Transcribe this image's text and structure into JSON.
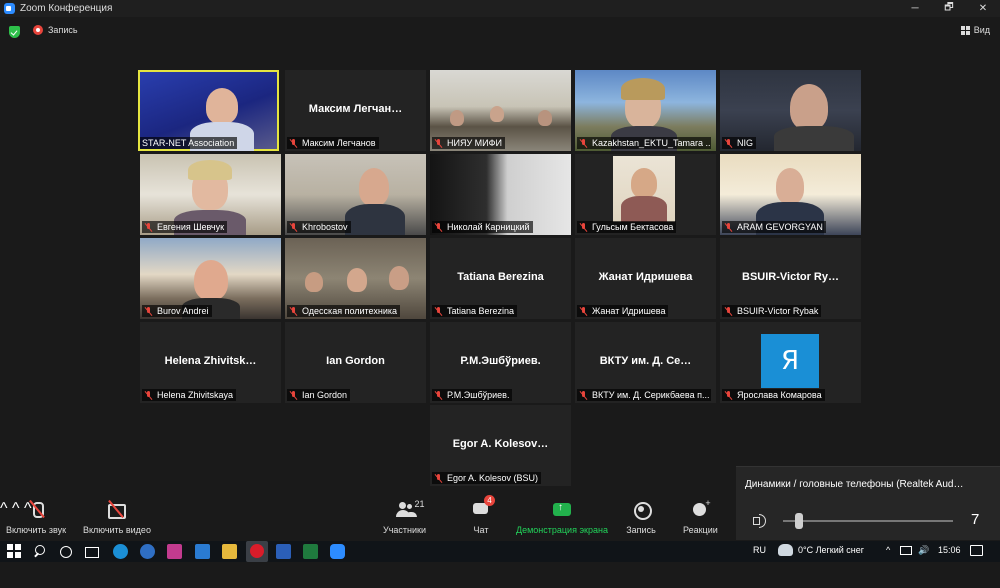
{
  "window": {
    "title": "Zoom Конференция",
    "minimize": "─",
    "maximize": "🗗",
    "close": "✕"
  },
  "topbar": {
    "recording": "Запись",
    "view": "Вид"
  },
  "tiles": [
    {
      "id": "star",
      "label": "STAR-NET Association",
      "big": "",
      "video": true,
      "muted": false,
      "active": true
    },
    {
      "id": "maksim",
      "label": "Максим Легчанов",
      "big": "Максим Легчан…",
      "video": false,
      "muted": true
    },
    {
      "id": "niyau",
      "label": "НИЯУ МИФИ",
      "big": "",
      "video": true,
      "muted": true
    },
    {
      "id": "kaz",
      "label": "Kazakhstan_EKTU_Tamara ...",
      "big": "",
      "video": true,
      "muted": true
    },
    {
      "id": "nig",
      "label": "NIG",
      "big": "",
      "video": true,
      "muted": true
    },
    {
      "id": "shevchuk",
      "label": "Евгения Шевчук",
      "big": "",
      "video": true,
      "muted": true
    },
    {
      "id": "khrobostov",
      "label": "Khrobostov",
      "big": "",
      "video": true,
      "muted": true
    },
    {
      "id": "karnitsky",
      "label": "Николай Карницкий",
      "big": "",
      "video": true,
      "muted": true
    },
    {
      "id": "bektasova",
      "label": "Гульсым Бектасова",
      "big": "",
      "video": true,
      "muted": true
    },
    {
      "id": "aram",
      "label": "ARAM GEVORGYAN",
      "big": "",
      "video": true,
      "muted": true
    },
    {
      "id": "burov",
      "label": "Burov Andrei",
      "big": "",
      "video": true,
      "muted": true
    },
    {
      "id": "odessa",
      "label": "Одесская политехника",
      "big": "",
      "video": true,
      "muted": true
    },
    {
      "id": "berezina",
      "label": "Tatiana Berezina",
      "big": "Tatiana Berezina",
      "video": false,
      "muted": true
    },
    {
      "id": "idrisheva",
      "label": "Жанат Идришева",
      "big": "Жанат Идришева",
      "video": false,
      "muted": true
    },
    {
      "id": "bsuir",
      "label": "BSUIR-Victor Rybak",
      "big": "BSUIR-Victor Ry…",
      "video": false,
      "muted": true
    },
    {
      "id": "zhivitskaya",
      "label": "Helena Zhivitskaya",
      "big": "Helena Zhivitsk…",
      "video": false,
      "muted": true
    },
    {
      "id": "gordon",
      "label": "Ian Gordon",
      "big": "Ian Gordon",
      "video": false,
      "muted": true
    },
    {
      "id": "eshburiev",
      "label": "Р.М.Эшбўриев.",
      "big": "Р.М.Эшбўриев.",
      "video": false,
      "muted": true
    },
    {
      "id": "vktu",
      "label": "ВКТУ им. Д. Серикбаева п...",
      "big": "ВКТУ им. Д. Се…",
      "video": false,
      "muted": true
    },
    {
      "id": "komarova",
      "label": "Ярослава Комарова",
      "big": "",
      "avatar": "Я",
      "video": false,
      "muted": true
    },
    {
      "id": "kolesov",
      "label": "Egor A. Kolesov (BSU)",
      "big": "Egor A. Kolesov…",
      "video": false,
      "muted": true
    }
  ],
  "audio_popup": {
    "device": "Динамики / головные телефоны (Realtek Aud…",
    "volume": "7",
    "volume_level": 0.07
  },
  "toolbar": {
    "audio": "Включить звук",
    "video": "Включить видео",
    "participants": "Участники",
    "participants_count": "21",
    "chat": "Чат",
    "chat_badge": "4",
    "share": "Демонстрация экрана",
    "record": "Запись",
    "reactions": "Реакции",
    "caret": "^"
  },
  "taskbar": {
    "lang": "RU",
    "weather": "0°C  Легкий снег",
    "time": "15:06"
  },
  "colors": {
    "accent": "#2d8cff",
    "share": "#22b14c",
    "active_border": "#e5e540",
    "muted": "#e8453c"
  }
}
